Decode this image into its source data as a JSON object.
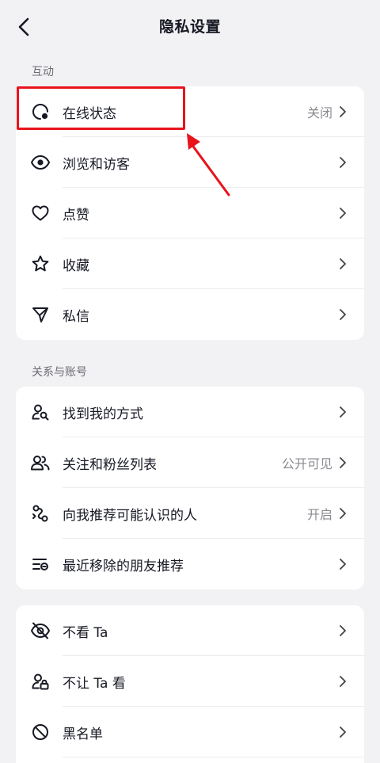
{
  "header": {
    "title": "隐私设置"
  },
  "sections": [
    {
      "label": "互动"
    },
    {
      "label": "关系与账号"
    }
  ],
  "interaction": {
    "items": [
      {
        "label": "在线状态",
        "value": "关闭",
        "icon": "online-status-icon"
      },
      {
        "label": "浏览和访客",
        "value": "",
        "icon": "eye-icon"
      },
      {
        "label": "点赞",
        "value": "",
        "icon": "heart-icon"
      },
      {
        "label": "收藏",
        "value": "",
        "icon": "star-icon"
      },
      {
        "label": "私信",
        "value": "",
        "icon": "send-icon"
      }
    ]
  },
  "relationship": {
    "items": [
      {
        "label": "找到我的方式",
        "value": "",
        "icon": "user-search-icon"
      },
      {
        "label": "关注和粉丝列表",
        "value": "公开可见",
        "icon": "users-icon"
      },
      {
        "label": "向我推荐可能认识的人",
        "value": "开启",
        "icon": "recommend-people-icon"
      },
      {
        "label": "最近移除的朋友推荐",
        "value": "",
        "icon": "removed-list-icon"
      }
    ]
  },
  "blocking": {
    "items": [
      {
        "label": "不看 Ta",
        "value": "",
        "icon": "eye-off-icon"
      },
      {
        "label": "不让 Ta 看",
        "value": "",
        "icon": "user-lock-icon"
      },
      {
        "label": "黑名单",
        "value": "",
        "icon": "block-icon"
      }
    ]
  },
  "colors": {
    "background": "#f2f2f4",
    "card": "#ffffff",
    "annotation": "#e8131b",
    "secondary_text": "#8a8b91"
  }
}
